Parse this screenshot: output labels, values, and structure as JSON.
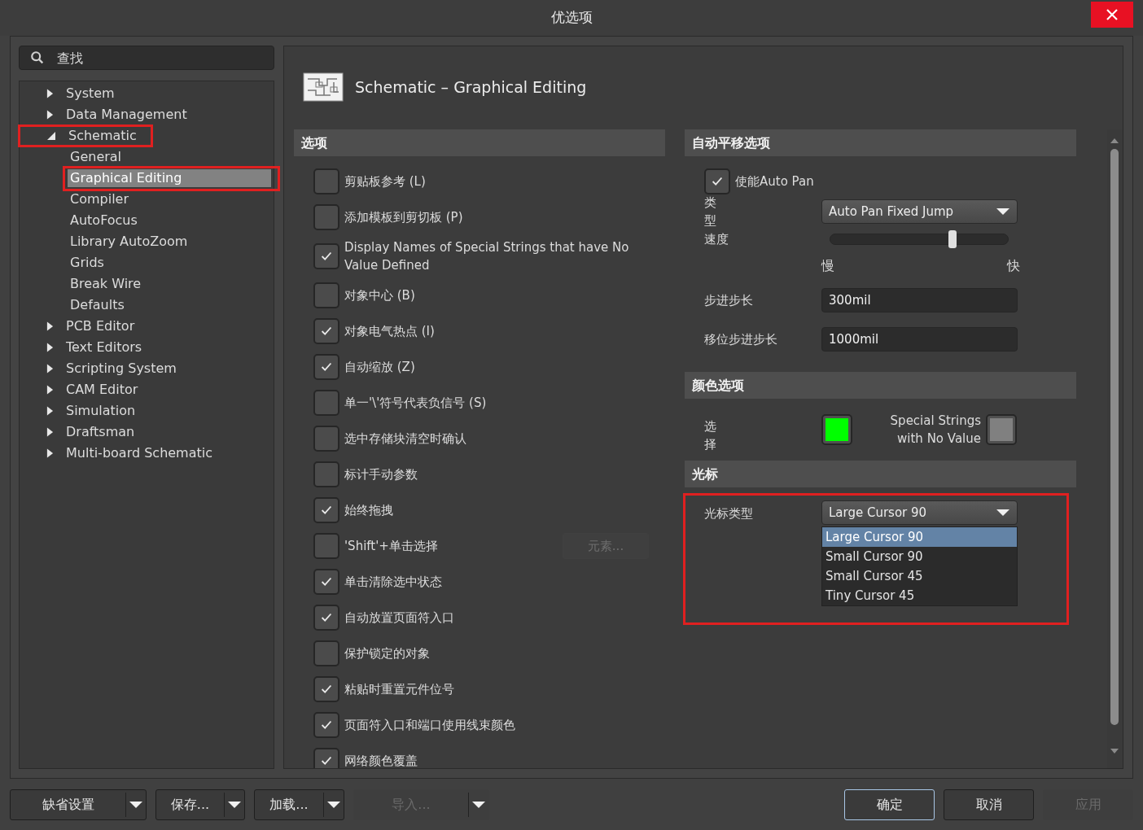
{
  "window": {
    "title": "优选项"
  },
  "search": {
    "placeholder": "查找"
  },
  "tree": [
    {
      "label": "System",
      "expanded": false,
      "selected": false,
      "highlighted": false
    },
    {
      "label": "Data Management",
      "expanded": false,
      "selected": false,
      "highlighted": false
    },
    {
      "label": "Schematic",
      "expanded": true,
      "selected": false,
      "highlighted": true,
      "children": [
        {
          "label": "General",
          "selected": false,
          "highlighted": false
        },
        {
          "label": "Graphical Editing",
          "selected": true,
          "highlighted": true
        },
        {
          "label": "Compiler",
          "selected": false,
          "highlighted": false
        },
        {
          "label": "AutoFocus",
          "selected": false,
          "highlighted": false
        },
        {
          "label": "Library AutoZoom",
          "selected": false,
          "highlighted": false
        },
        {
          "label": "Grids",
          "selected": false,
          "highlighted": false
        },
        {
          "label": "Break Wire",
          "selected": false,
          "highlighted": false
        },
        {
          "label": "Defaults",
          "selected": false,
          "highlighted": false
        }
      ]
    },
    {
      "label": "PCB Editor",
      "expanded": false,
      "selected": false,
      "highlighted": false
    },
    {
      "label": "Text Editors",
      "expanded": false,
      "selected": false,
      "highlighted": false
    },
    {
      "label": "Scripting System",
      "expanded": false,
      "selected": false,
      "highlighted": false
    },
    {
      "label": "CAM Editor",
      "expanded": false,
      "selected": false,
      "highlighted": false
    },
    {
      "label": "Simulation",
      "expanded": false,
      "selected": false,
      "highlighted": false
    },
    {
      "label": "Draftsman",
      "expanded": false,
      "selected": false,
      "highlighted": false
    },
    {
      "label": "Multi-board Schematic",
      "expanded": false,
      "selected": false,
      "highlighted": false
    }
  ],
  "page": {
    "title": "Schematic – Graphical Editing"
  },
  "options": {
    "title": "选项",
    "items": [
      {
        "label": "剪贴板参考 (L)",
        "checked": false
      },
      {
        "label": "添加模板到剪切板 (P)",
        "checked": false
      },
      {
        "label": "Display Names of Special Strings that have No Value Defined",
        "checked": true
      },
      {
        "label": "对象中心 (B)",
        "checked": false
      },
      {
        "label": "对象电气热点 (I)",
        "checked": true
      },
      {
        "label": "自动缩放 (Z)",
        "checked": true
      },
      {
        "label": "单一'\\'符号代表负信号 (S)",
        "checked": false
      },
      {
        "label": "选中存储块清空时确认",
        "checked": false
      },
      {
        "label": "标计手动参数",
        "checked": false
      },
      {
        "label": "始终拖拽",
        "checked": true
      },
      {
        "label": "'Shift'+单击选择",
        "checked": false,
        "button": {
          "label": "元素...",
          "disabled": true
        }
      },
      {
        "label": "单击清除选中状态",
        "checked": true
      },
      {
        "label": "自动放置页面符入口",
        "checked": true
      },
      {
        "label": "保护锁定的对象",
        "checked": false
      },
      {
        "label": "粘贴时重置元件位号",
        "checked": true
      },
      {
        "label": "页面符入口和端口使用线束颜色",
        "checked": true
      },
      {
        "label": "网络颜色覆盖",
        "checked": true
      }
    ]
  },
  "auto_pan": {
    "title": "自动平移选项",
    "enable": {
      "label": "使能Auto Pan",
      "checked": true
    },
    "type": {
      "label": "类型",
      "value": "Auto Pan Fixed Jump"
    },
    "speed": {
      "label": "速度",
      "level": 0.68,
      "min_label": "慢",
      "max_label": "快"
    },
    "step": {
      "label": "步进步长",
      "value": "300mil"
    },
    "shift_step": {
      "label": "移位步进步长",
      "value": "1000mil"
    }
  },
  "colors": {
    "title": "颜色选项",
    "items": [
      {
        "label": "选择",
        "color": "#00ff00"
      },
      {
        "label": "Special Strings with No Value",
        "color": "#808080"
      }
    ]
  },
  "cursor": {
    "title": "光标",
    "label": "光标类型",
    "value": "Large Cursor 90",
    "highlighted": true,
    "options": [
      {
        "label": "Large Cursor 90",
        "selected": true
      },
      {
        "label": "Small Cursor 90",
        "selected": false
      },
      {
        "label": "Small Cursor 45",
        "selected": false
      },
      {
        "label": "Tiny Cursor 45",
        "selected": false
      }
    ]
  },
  "footer": {
    "left": [
      {
        "label": "缺省设置",
        "disabled": false
      },
      {
        "label": "保存...",
        "disabled": false
      },
      {
        "label": "加载...",
        "disabled": false
      },
      {
        "label": "导入...",
        "disabled": true
      }
    ],
    "right": [
      {
        "label": "确定",
        "default": true,
        "disabled": false
      },
      {
        "label": "取消",
        "default": false,
        "disabled": false
      },
      {
        "label": "应用",
        "default": false,
        "disabled": true
      }
    ]
  }
}
